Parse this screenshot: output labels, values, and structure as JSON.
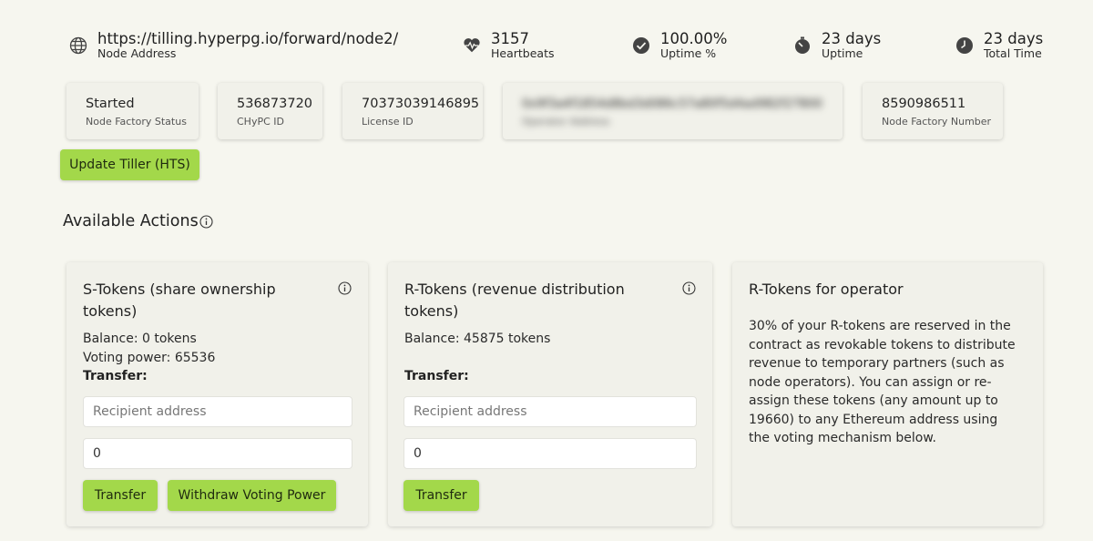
{
  "header": {
    "node_address": {
      "value": "https://tilling.hyperpg.io/forward/node2/",
      "label": "Node Address",
      "icon": "globe-icon"
    },
    "heartbeats": {
      "value": "3157",
      "label": "Heartbeats",
      "icon": "heartbeat-icon"
    },
    "uptime_pct": {
      "value": "100.00%",
      "label": "Uptime %",
      "icon": "check-circle-icon"
    },
    "uptime": {
      "value": "23 days",
      "label": "Uptime",
      "icon": "stopwatch-icon"
    },
    "total_time": {
      "value": "23 days",
      "label": "Total Time",
      "icon": "clock-icon"
    }
  },
  "info_cards": {
    "status": {
      "value": "Started",
      "label": "Node Factory Status"
    },
    "chypc": {
      "value": "536873720",
      "label": "CHyPC ID"
    },
    "license": {
      "value": "70373039146895",
      "label": "License ID"
    },
    "operator": {
      "value": "0x9f3a4f1854d8bd3d086c57a80f5d4ad982f27800",
      "label": "Operator Address"
    },
    "factory_number": {
      "value": "8590986511",
      "label": "Node Factory Number"
    }
  },
  "update_button": "Update Tiller (HTS)",
  "actions": {
    "title": "Available Actions",
    "s_tokens": {
      "title": "S-Tokens (share ownership tokens)",
      "balance": "Balance: 0 tokens",
      "voting": "Voting power: 65536",
      "transfer_label": "Transfer:",
      "recipient_placeholder": "Recipient address",
      "amount": "0",
      "transfer_btn": "Transfer",
      "withdraw_btn": "Withdraw Voting Power"
    },
    "r_tokens": {
      "title": "R-Tokens (revenue distribution tokens)",
      "balance": "Balance: 45875 tokens",
      "transfer_label": "Transfer:",
      "recipient_placeholder": "Recipient address",
      "amount": "0",
      "transfer_btn": "Transfer"
    },
    "r_operator": {
      "title": "R-Tokens for operator",
      "description": "30% of your R-tokens are reserved in the contract as revokable tokens to distribute revenue to temporary partners (such as node operators). You can assign or re-assign these tokens (any amount up to 19660) to any Ethereum address using the voting mechanism below."
    }
  },
  "colors": {
    "background": "#f6f6ef",
    "card": "#f1f1ea",
    "accent": "#a3d84a"
  }
}
